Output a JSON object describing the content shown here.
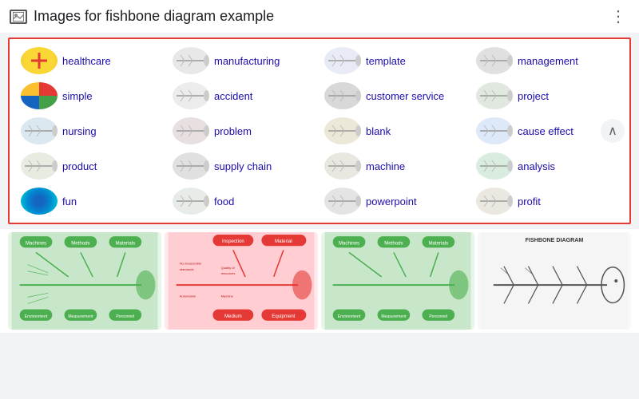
{
  "header": {
    "title": "Images for fishbone diagram example",
    "more_label": "⋮"
  },
  "tags": [
    {
      "id": "healthcare",
      "label": "healthcare",
      "thumbClass": "thumb-healthcare"
    },
    {
      "id": "manufacturing",
      "label": "manufacturing",
      "thumbClass": "thumb-manufacturing"
    },
    {
      "id": "template",
      "label": "template",
      "thumbClass": "thumb-template"
    },
    {
      "id": "management",
      "label": "management",
      "thumbClass": "thumb-management"
    },
    {
      "id": "simple",
      "label": "simple",
      "thumbClass": "thumb-simple"
    },
    {
      "id": "accident",
      "label": "accident",
      "thumbClass": "thumb-accident"
    },
    {
      "id": "customerservice",
      "label": "customer service",
      "thumbClass": "thumb-customerservice"
    },
    {
      "id": "project",
      "label": "project",
      "thumbClass": "thumb-project"
    },
    {
      "id": "nursing",
      "label": "nursing",
      "thumbClass": "thumb-nursing"
    },
    {
      "id": "problem",
      "label": "problem",
      "thumbClass": "thumb-problem"
    },
    {
      "id": "blank",
      "label": "blank",
      "thumbClass": "thumb-blank"
    },
    {
      "id": "causeeffect",
      "label": "cause effect",
      "thumbClass": "thumb-causeeffect"
    },
    {
      "id": "product",
      "label": "product",
      "thumbClass": "thumb-product"
    },
    {
      "id": "supplychain",
      "label": "supply chain",
      "thumbClass": "thumb-supplychain"
    },
    {
      "id": "machine",
      "label": "machine",
      "thumbClass": "thumb-machine"
    },
    {
      "id": "analysis",
      "label": "analysis",
      "thumbClass": "thumb-analysis"
    },
    {
      "id": "fun",
      "label": "fun",
      "thumbClass": "thumb-fun"
    },
    {
      "id": "food",
      "label": "food",
      "thumbClass": "thumb-food"
    },
    {
      "id": "powerpoint",
      "label": "powerpoint",
      "thumbClass": "thumb-powerpoint"
    },
    {
      "id": "profit",
      "label": "profit",
      "thumbClass": "thumb-profit"
    }
  ],
  "chevron": "∧",
  "colors": {
    "border": "#e53935",
    "link": "#1a0dab"
  }
}
